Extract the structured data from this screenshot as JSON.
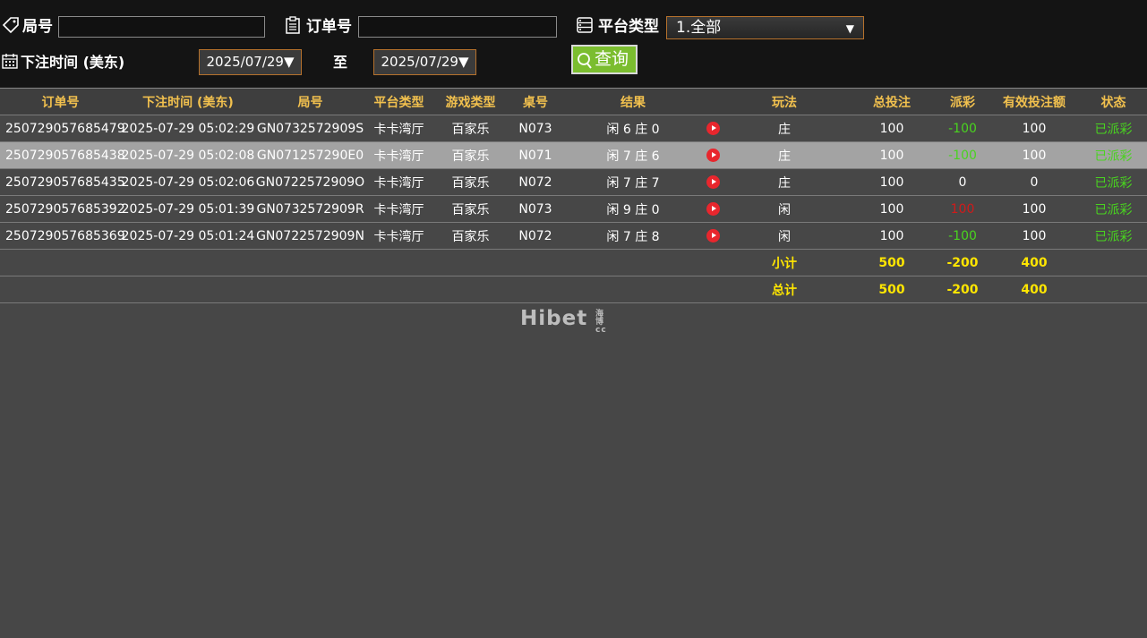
{
  "filters": {
    "round_label": "局号",
    "order_label": "订单号",
    "platform_label": "平台类型",
    "platform_selected": "1.全部",
    "time_label": "下注时间 (美东)",
    "date_from": "2025/07/29▼",
    "to_label": "至",
    "date_to": "2025/07/29▼",
    "query_label": "查询"
  },
  "table": {
    "headers": [
      "订单号",
      "下注时间 (美东)",
      "局号",
      "平台类型",
      "游戏类型",
      "桌号",
      "结果",
      "",
      "玩法",
      "总投注",
      "派彩",
      "有效投注额",
      "状态"
    ],
    "rows": [
      {
        "order": "250729057685479",
        "time": "2025-07-29 05:02:29",
        "round": "GN0732572909S",
        "platform": "卡卡湾厅",
        "game": "百家乐",
        "table": "N073",
        "result": "闲 6 庄 0",
        "play": "庄",
        "bet": "100",
        "payout": "-100",
        "payout_color": "green",
        "valid": "100",
        "status": "已派彩"
      },
      {
        "order": "250729057685438",
        "time": "2025-07-29 05:02:08",
        "round": "GN071257290E0",
        "platform": "卡卡湾厅",
        "game": "百家乐",
        "table": "N071",
        "result": "闲 7 庄 6",
        "play": "庄",
        "bet": "100",
        "payout": "-100",
        "payout_color": "green",
        "valid": "100",
        "status": "已派彩"
      },
      {
        "order": "250729057685435",
        "time": "2025-07-29 05:02:06",
        "round": "GN0722572909O",
        "platform": "卡卡湾厅",
        "game": "百家乐",
        "table": "N072",
        "result": "闲 7 庄 7",
        "play": "庄",
        "bet": "100",
        "payout": "0",
        "payout_color": "white",
        "valid": "0",
        "status": "已派彩"
      },
      {
        "order": "250729057685392",
        "time": "2025-07-29 05:01:39",
        "round": "GN0732572909R",
        "platform": "卡卡湾厅",
        "game": "百家乐",
        "table": "N073",
        "result": "闲 9 庄 0",
        "play": "闲",
        "bet": "100",
        "payout": "100",
        "payout_color": "red",
        "valid": "100",
        "status": "已派彩"
      },
      {
        "order": "250729057685369",
        "time": "2025-07-29 05:01:24",
        "round": "GN0722572909N",
        "platform": "卡卡湾厅",
        "game": "百家乐",
        "table": "N072",
        "result": "闲 7 庄 8",
        "play": "闲",
        "bet": "100",
        "payout": "-100",
        "payout_color": "green",
        "valid": "100",
        "status": "已派彩"
      }
    ],
    "subtotal": {
      "label": "小计",
      "bet": "500",
      "payout": "-200",
      "valid": "400"
    },
    "total": {
      "label": "总计",
      "bet": "500",
      "payout": "-200",
      "valid": "400"
    }
  },
  "logo": {
    "text": "Hibet",
    "suffix_cn": "海博",
    "suffix": "cc"
  },
  "colors": {
    "accent": "#f2c14e",
    "win_green": "#49d41f",
    "loss_red": "#d01a1a",
    "total_yellow": "#ffe600",
    "query_green": "#7bbd2f",
    "border_orange": "#b5712c"
  },
  "icons": {
    "round": "tag-icon",
    "order": "clipboard-icon",
    "platform": "server-icon",
    "time": "calendar-icon",
    "query": "search-icon",
    "video": "play-icon"
  }
}
